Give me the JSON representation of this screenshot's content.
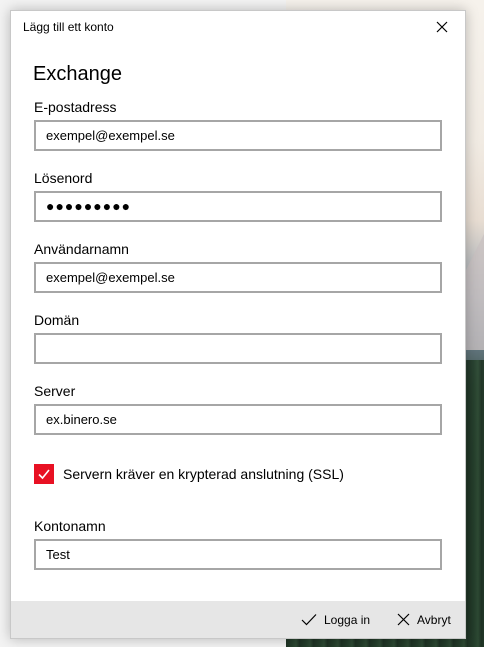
{
  "window": {
    "title": "Lägg till ett konto"
  },
  "form": {
    "heading": "Exchange",
    "email": {
      "label": "E-postadress",
      "value": "exempel@exempel.se"
    },
    "password": {
      "label": "Lösenord",
      "value": "●●●●●●●●●"
    },
    "username": {
      "label": "Användarnamn",
      "value": "exempel@exempel.se"
    },
    "domain": {
      "label": "Domän",
      "value": ""
    },
    "server": {
      "label": "Server",
      "value": "ex.binero.se"
    },
    "ssl": {
      "label": "Servern kräver en krypterad anslutning (SSL)",
      "checked": true
    },
    "account_name": {
      "label": "Kontonamn",
      "value": "Test"
    }
  },
  "footer": {
    "login_label": "Logga in",
    "cancel_label": "Avbryt"
  },
  "icons": {
    "close": "close-icon",
    "checkmark": "checkmark-icon",
    "cancel": "close-icon"
  },
  "colors": {
    "accent": "#e81123",
    "footer_bg": "#e6e6e6",
    "input_border": "#a6a6a6"
  }
}
